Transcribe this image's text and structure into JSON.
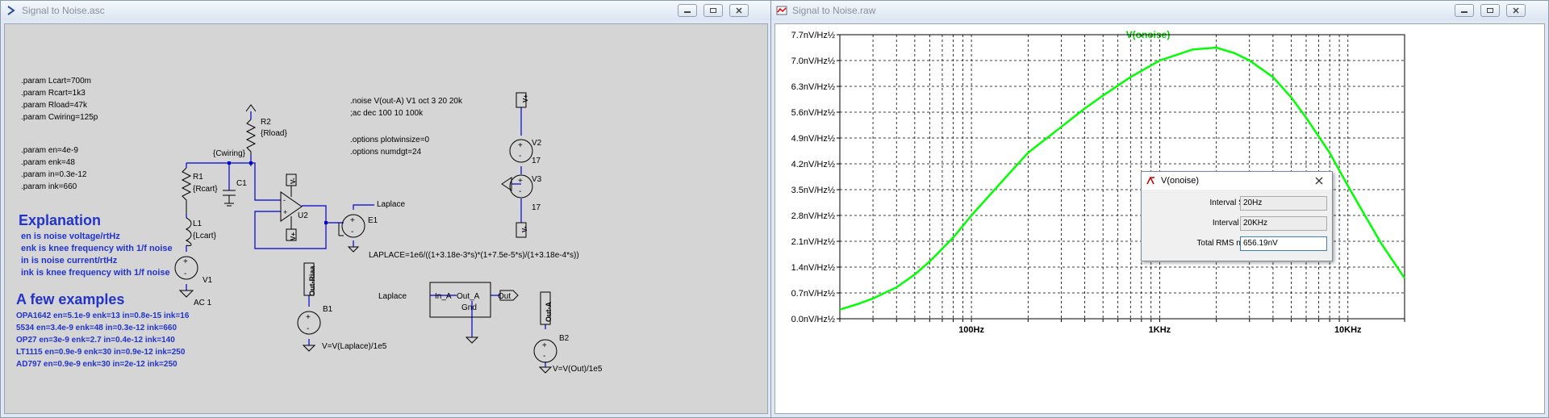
{
  "schematic_window": {
    "title": "Signal to Noise.asc",
    "params": [
      ".param Lcart=700m",
      ".param Rcart=1k3",
      ".param Rload=47k",
      ".param Cwiring=125p"
    ],
    "params2": [
      ".param en=4e-9",
      ".param enk=48",
      ".param in=0.3e-12",
      ".param ink=660"
    ],
    "explanation_heading": "Explanation",
    "explanation_lines": [
      "en is noise voltage/rtHz",
      "enk is knee frequency with 1/f noise",
      "in is noise current/rtHz",
      "ink is knee frequency with 1/f noise"
    ],
    "examples_heading": "A few examples",
    "examples": [
      "OPA1642 en=5.1e-9 enk=13 in=0.8e-15 ink=16",
      "5534 en=3.4e-9 enk=48 in=0.3e-12 ink=660",
      "OP27 en=3e-9 enk=2.7 in=0.4e-12 ink=140",
      "LT1115 en=0.9e-9 enk=30 in=0.9e-12 ink=250",
      "AD797 en=0.9e-9 enk=30 in=2e-12 ink=250"
    ],
    "directives": [
      ".noise V(out-A) V1 oct 3 20 20k",
      ";ac dec 100 10 100k",
      ".options plotwinsize=0",
      ".options numdgt=24"
    ],
    "labels": {
      "r2": "R2",
      "rload": "{Rload}",
      "cwiring": "{Cwiring}",
      "r1": "R1",
      "rcart": "{Rcart}",
      "c1": "C1",
      "l1": "L1",
      "lcart": "{Lcart}",
      "v1": "V1",
      "ac1": "AC 1",
      "u2": "U2",
      "vplus": "V+",
      "vminus": "V-",
      "e1": "E1",
      "laplace": "Laplace",
      "laplace_expr": "LAPLACE=1e6/((1+3.18e-3*s)*(1+7.5e-5*s)/(1+3.18e-4*s))",
      "v2": "V2",
      "v3": "V3",
      "v2_val": "17",
      "v3_val": "17",
      "out_riaa": "Out-Riaa",
      "b1": "B1",
      "b1_expr": "V=V(Laplace)/1e5",
      "block_in": "In_A",
      "block_out": "Out_A",
      "block_gnd": "Gnd",
      "laplace_in": "Laplace",
      "out_label": "Out",
      "out_a": "Out-A",
      "b2": "B2",
      "b2_expr": "V=V(Out)/1e5"
    }
  },
  "plot_window": {
    "title": "Signal to Noise.raw",
    "trace_label": "V(onoise)"
  },
  "dialog": {
    "title": "V(onoise)",
    "interval_start_label": "Interval Start:",
    "interval_start_value": "20Hz",
    "interval_end_label": "Interval End:",
    "interval_end_value": "20KHz",
    "rms_label": "Total RMS noise:",
    "rms_value": "656.19nV"
  },
  "colors": {
    "trace": "#00ff00",
    "schematic_text": "#0000aa",
    "heading": "#2233cc",
    "wire": "#0000cc"
  },
  "chart_data": {
    "type": "line",
    "x_scale": "log",
    "xlim": [
      20,
      20000
    ],
    "ylim": [
      0,
      7.7
    ],
    "ylabel_unit": "nV/Hz½",
    "y_ticks": [
      "0.0nV/Hz½",
      "0.7nV/Hz½",
      "1.4nV/Hz½",
      "2.1nV/Hz½",
      "2.8nV/Hz½",
      "3.5nV/Hz½",
      "4.2nV/Hz½",
      "4.9nV/Hz½",
      "5.6nV/Hz½",
      "6.3nV/Hz½",
      "7.0nV/Hz½",
      "7.7nV/Hz½"
    ],
    "y_tick_values": [
      0,
      0.7,
      1.4,
      2.1,
      2.8,
      3.5,
      4.2,
      4.9,
      5.6,
      6.3,
      7.0,
      7.7
    ],
    "x_tick_labels": [
      "100Hz",
      "1KHz",
      "10KHz"
    ],
    "x_tick_values": [
      100,
      1000,
      10000
    ],
    "grid": true,
    "series": [
      {
        "name": "V(onoise)",
        "x": [
          20,
          25,
          30,
          40,
          50,
          60,
          80,
          100,
          150,
          200,
          300,
          400,
          500,
          700,
          1000,
          1500,
          2000,
          2500,
          3000,
          4000,
          5000,
          6000,
          8000,
          10000,
          12000,
          15000,
          20000
        ],
        "y": [
          0.25,
          0.4,
          0.55,
          0.85,
          1.2,
          1.55,
          2.2,
          2.8,
          3.8,
          4.5,
          5.2,
          5.7,
          6.05,
          6.55,
          7.0,
          7.3,
          7.35,
          7.2,
          7.0,
          6.55,
          6.0,
          5.45,
          4.5,
          3.6,
          2.9,
          2.05,
          1.1
        ]
      }
    ]
  }
}
